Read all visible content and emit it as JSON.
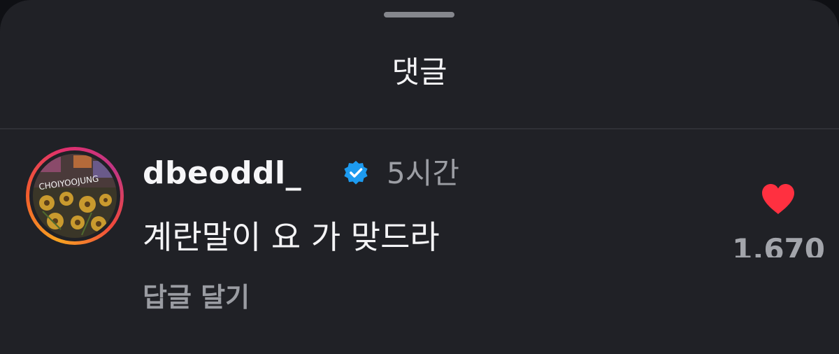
{
  "sheet": {
    "title": "댓글"
  },
  "comment": {
    "username": "dbeoddl_",
    "verified": true,
    "timestamp": "5시간",
    "text": "계란말이 요 가 맞드라",
    "reply_label": "답글 달기",
    "like_count": "1.670",
    "liked": true,
    "avatar_lettering": "CHOIYOOJUNG"
  },
  "colors": {
    "background": "#202126",
    "heart": "#ff3040",
    "verified": "#1d9bf0",
    "muted_text": "#9c9ea4"
  },
  "icons": {
    "verified": "verified-badge-icon",
    "like": "heart-icon",
    "handle": "drag-handle"
  }
}
